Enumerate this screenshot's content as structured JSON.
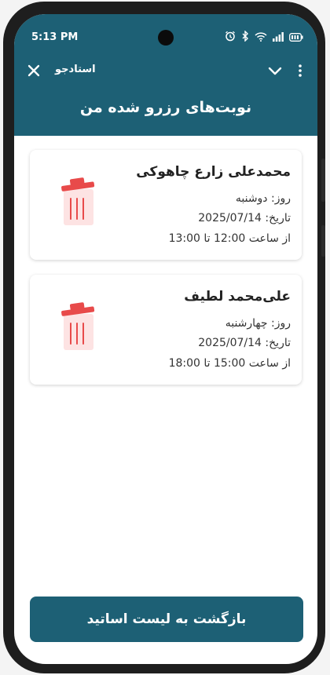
{
  "status_bar": {
    "time": "5:13 PM"
  },
  "top_bar": {
    "title": "استادجو"
  },
  "page": {
    "title": "نوبت‌های رزرو شده من"
  },
  "reservations": [
    {
      "name": "محمدعلی زارع چاهوکی",
      "day": "روز: دوشنبه",
      "date": "تاریخ: 2025/07/14",
      "time": "از ساعت 12:00 تا 13:00"
    },
    {
      "name": "علی‌محمد لطیف",
      "day": "روز: چهارشنبه",
      "date": "تاریخ: 2025/07/14",
      "time": "از ساعت 15:00 تا 18:00"
    }
  ],
  "footer": {
    "back_label": "بازگشت به لیست اساتید"
  },
  "colors": {
    "primary": "#1d6075",
    "trash_lid": "#e84a4a",
    "trash_body": "#fde3e3"
  },
  "icons": {
    "close": "close-icon",
    "chevron": "chevron-down-icon",
    "more": "more-vert-icon",
    "delete": "trash-icon",
    "alarm": "alarm-icon",
    "bluetooth": "bluetooth-icon",
    "wifi": "wifi-icon",
    "signal": "signal-icon",
    "battery": "battery-icon"
  }
}
